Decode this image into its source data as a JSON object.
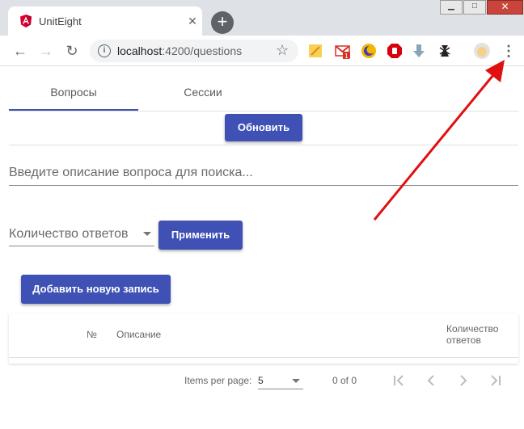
{
  "browser": {
    "tab_title": "UnitEight",
    "tab_close": "✕",
    "new_tab": "+",
    "url_host": "localhost",
    "url_path": ":4200/questions",
    "window_minimize": "▁",
    "window_maximize": "□",
    "window_close": "✕"
  },
  "tabs": [
    {
      "label": "Вопросы",
      "active": true
    },
    {
      "label": "Сессии",
      "active": false
    }
  ],
  "refresh_button": "Обновить",
  "search": {
    "placeholder": "Введите описание вопроса для поиска..."
  },
  "answers_filter": {
    "placeholder": "Количество ответов"
  },
  "apply_button": "Применить",
  "add_button": "Добавить новую запись",
  "table": {
    "headers": {
      "number": "№",
      "description": "Описание",
      "answers_line1": "Количество",
      "answers_line2": "ответов"
    }
  },
  "paginator": {
    "items_per_page_label": "Items per page:",
    "page_size": "5",
    "range": "0 of 0"
  },
  "colors": {
    "primary": "#3f51b5",
    "annotation_arrow": "#e01010"
  }
}
